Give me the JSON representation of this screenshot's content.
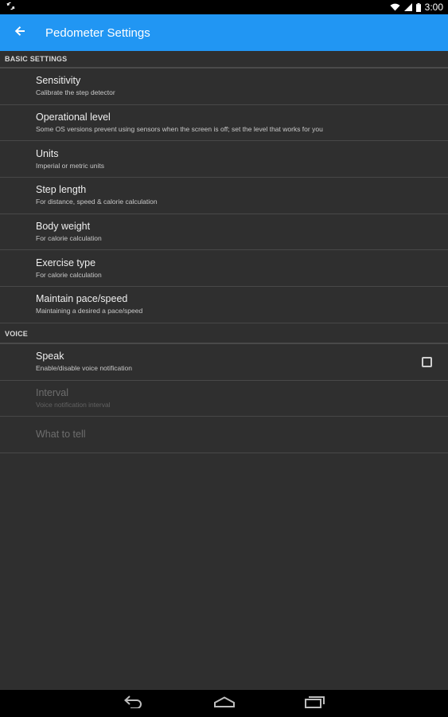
{
  "status_bar": {
    "time": "3:00",
    "icons": [
      "sync-icon",
      "wifi-icon",
      "signal-icon",
      "battery-icon"
    ]
  },
  "app_bar": {
    "title": "Pedometer Settings",
    "back_icon": "arrow-back-icon",
    "color": "#2196f3"
  },
  "sections": {
    "basic": {
      "header": "BASIC SETTINGS",
      "items": [
        {
          "title": "Sensitivity",
          "summary": "Calibrate the step detector"
        },
        {
          "title": "Operational level",
          "summary": "Some OS versions prevent using sensors when the screen is off; set the level that works for you"
        },
        {
          "title": "Units",
          "summary": "Imperial or metric units"
        },
        {
          "title": "Step length",
          "summary": "For distance, speed & calorie calculation"
        },
        {
          "title": "Body weight",
          "summary": "For calorie calculation"
        },
        {
          "title": "Exercise type",
          "summary": "For calorie calculation"
        },
        {
          "title": "Maintain pace/speed",
          "summary": "Maintaining a desired a pace/speed"
        }
      ]
    },
    "voice": {
      "header": "VOICE",
      "items": [
        {
          "title": "Speak",
          "summary": "Enable/disable voice notification",
          "checked": false
        },
        {
          "title": "Interval",
          "summary": "Voice notification interval",
          "enabled": false
        },
        {
          "title": "What to tell",
          "enabled": false
        }
      ]
    }
  },
  "nav_bar": {
    "icons": [
      "back-nav-icon",
      "home-nav-icon",
      "recents-nav-icon"
    ]
  }
}
